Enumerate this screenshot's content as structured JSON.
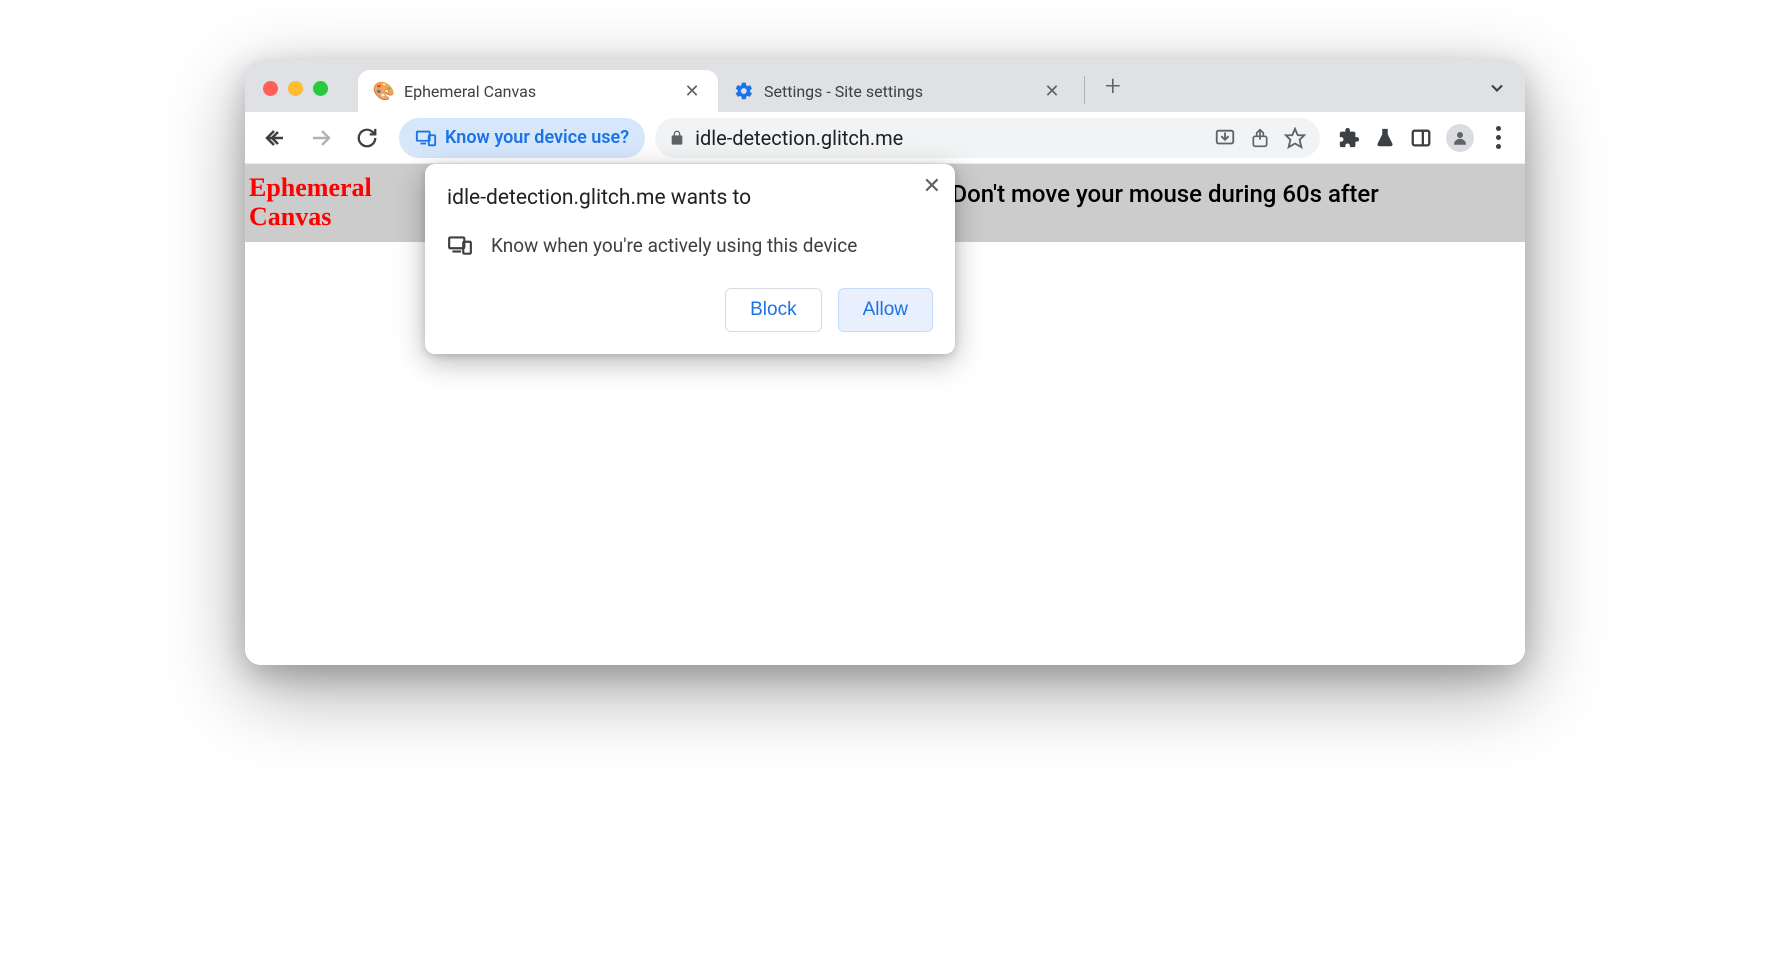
{
  "tabs": [
    {
      "title": "Ephemeral Canvas",
      "favicon": "🎨",
      "active": true
    },
    {
      "title": "Settings - Site settings",
      "favicon": "⚙️",
      "active": false
    }
  ],
  "permission_chip": {
    "label": "Know your device use?"
  },
  "url": "idle-detection.glitch.me",
  "page": {
    "title": "Ephemeral Canvas",
    "instruction": "[Don't move your mouse during 60s after"
  },
  "prompt": {
    "title": "idle-detection.glitch.me wants to",
    "permission_label": "Know when you're actively using this device",
    "block_label": "Block",
    "allow_label": "Allow"
  }
}
